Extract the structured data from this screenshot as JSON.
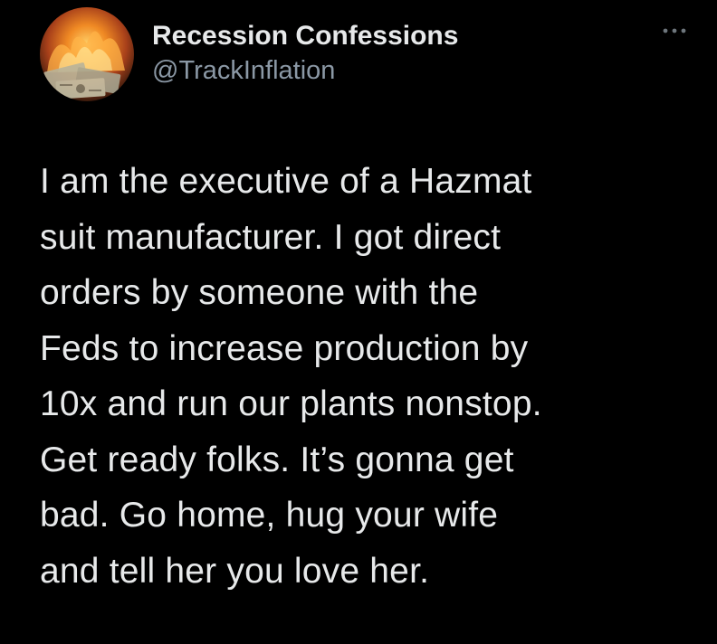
{
  "tweet": {
    "author": {
      "display_name": "Recession Confessions",
      "handle": "@TrackInflation",
      "avatar_icon": "burning-money-avatar-icon"
    },
    "more_icon": "more-options-icon",
    "text": "I am the executive of a Hazmat\nsuit manufacturer. I got direct\norders by someone with the\nFeds to increase production by\n10x and run our plants nonstop.\nGet ready folks. It’s gonna get\nbad. Go home, hug your wife\nand tell her you love her."
  },
  "colors": {
    "background": "#000000",
    "primary_text": "#e7e9ea",
    "secondary_text": "#8b98a5"
  }
}
